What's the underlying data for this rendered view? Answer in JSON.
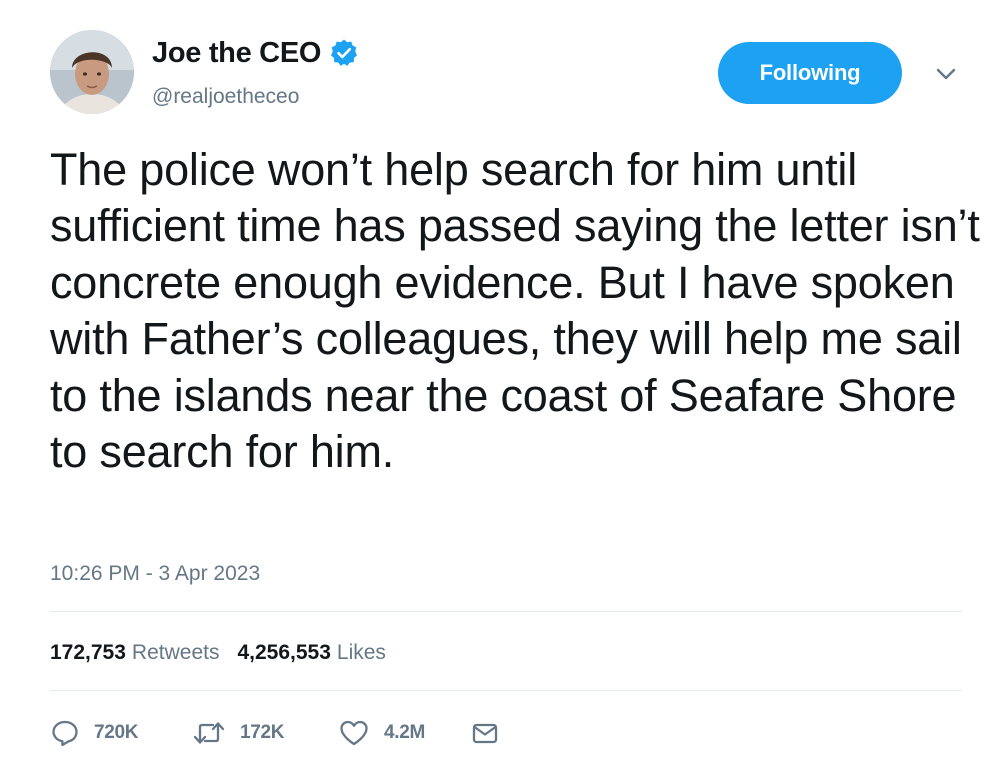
{
  "author": {
    "display_name": "Joe the CEO",
    "handle": "@realjoetheceo",
    "verified": true
  },
  "follow_button": {
    "label": "Following"
  },
  "tweet": {
    "text": "The police won’t help search for him until sufficient time has passed saying the letter isn’t concrete enough evidence. But I have spoken with Father’s colleagues, they will help me sail to the islands near the coast of Seafare Shore to search for him.",
    "timestamp": "10:26 PM - 3 Apr 2023"
  },
  "stats": {
    "retweets_count": "172,753",
    "retweets_label": "Retweets",
    "likes_count": "4,256,553",
    "likes_label": "Likes"
  },
  "actions": {
    "reply_count": "720K",
    "retweet_count": "172K",
    "like_count": "4.2M"
  },
  "colors": {
    "accent": "#1da1f2",
    "secondary_text": "#657786",
    "primary_text": "#14171a",
    "divider": "#e6ecf0"
  },
  "icons": {
    "verified": "verified-badge-icon",
    "caret": "chevron-down-icon",
    "reply": "reply-icon",
    "retweet": "retweet-icon",
    "like": "heart-icon",
    "message": "envelope-icon"
  }
}
